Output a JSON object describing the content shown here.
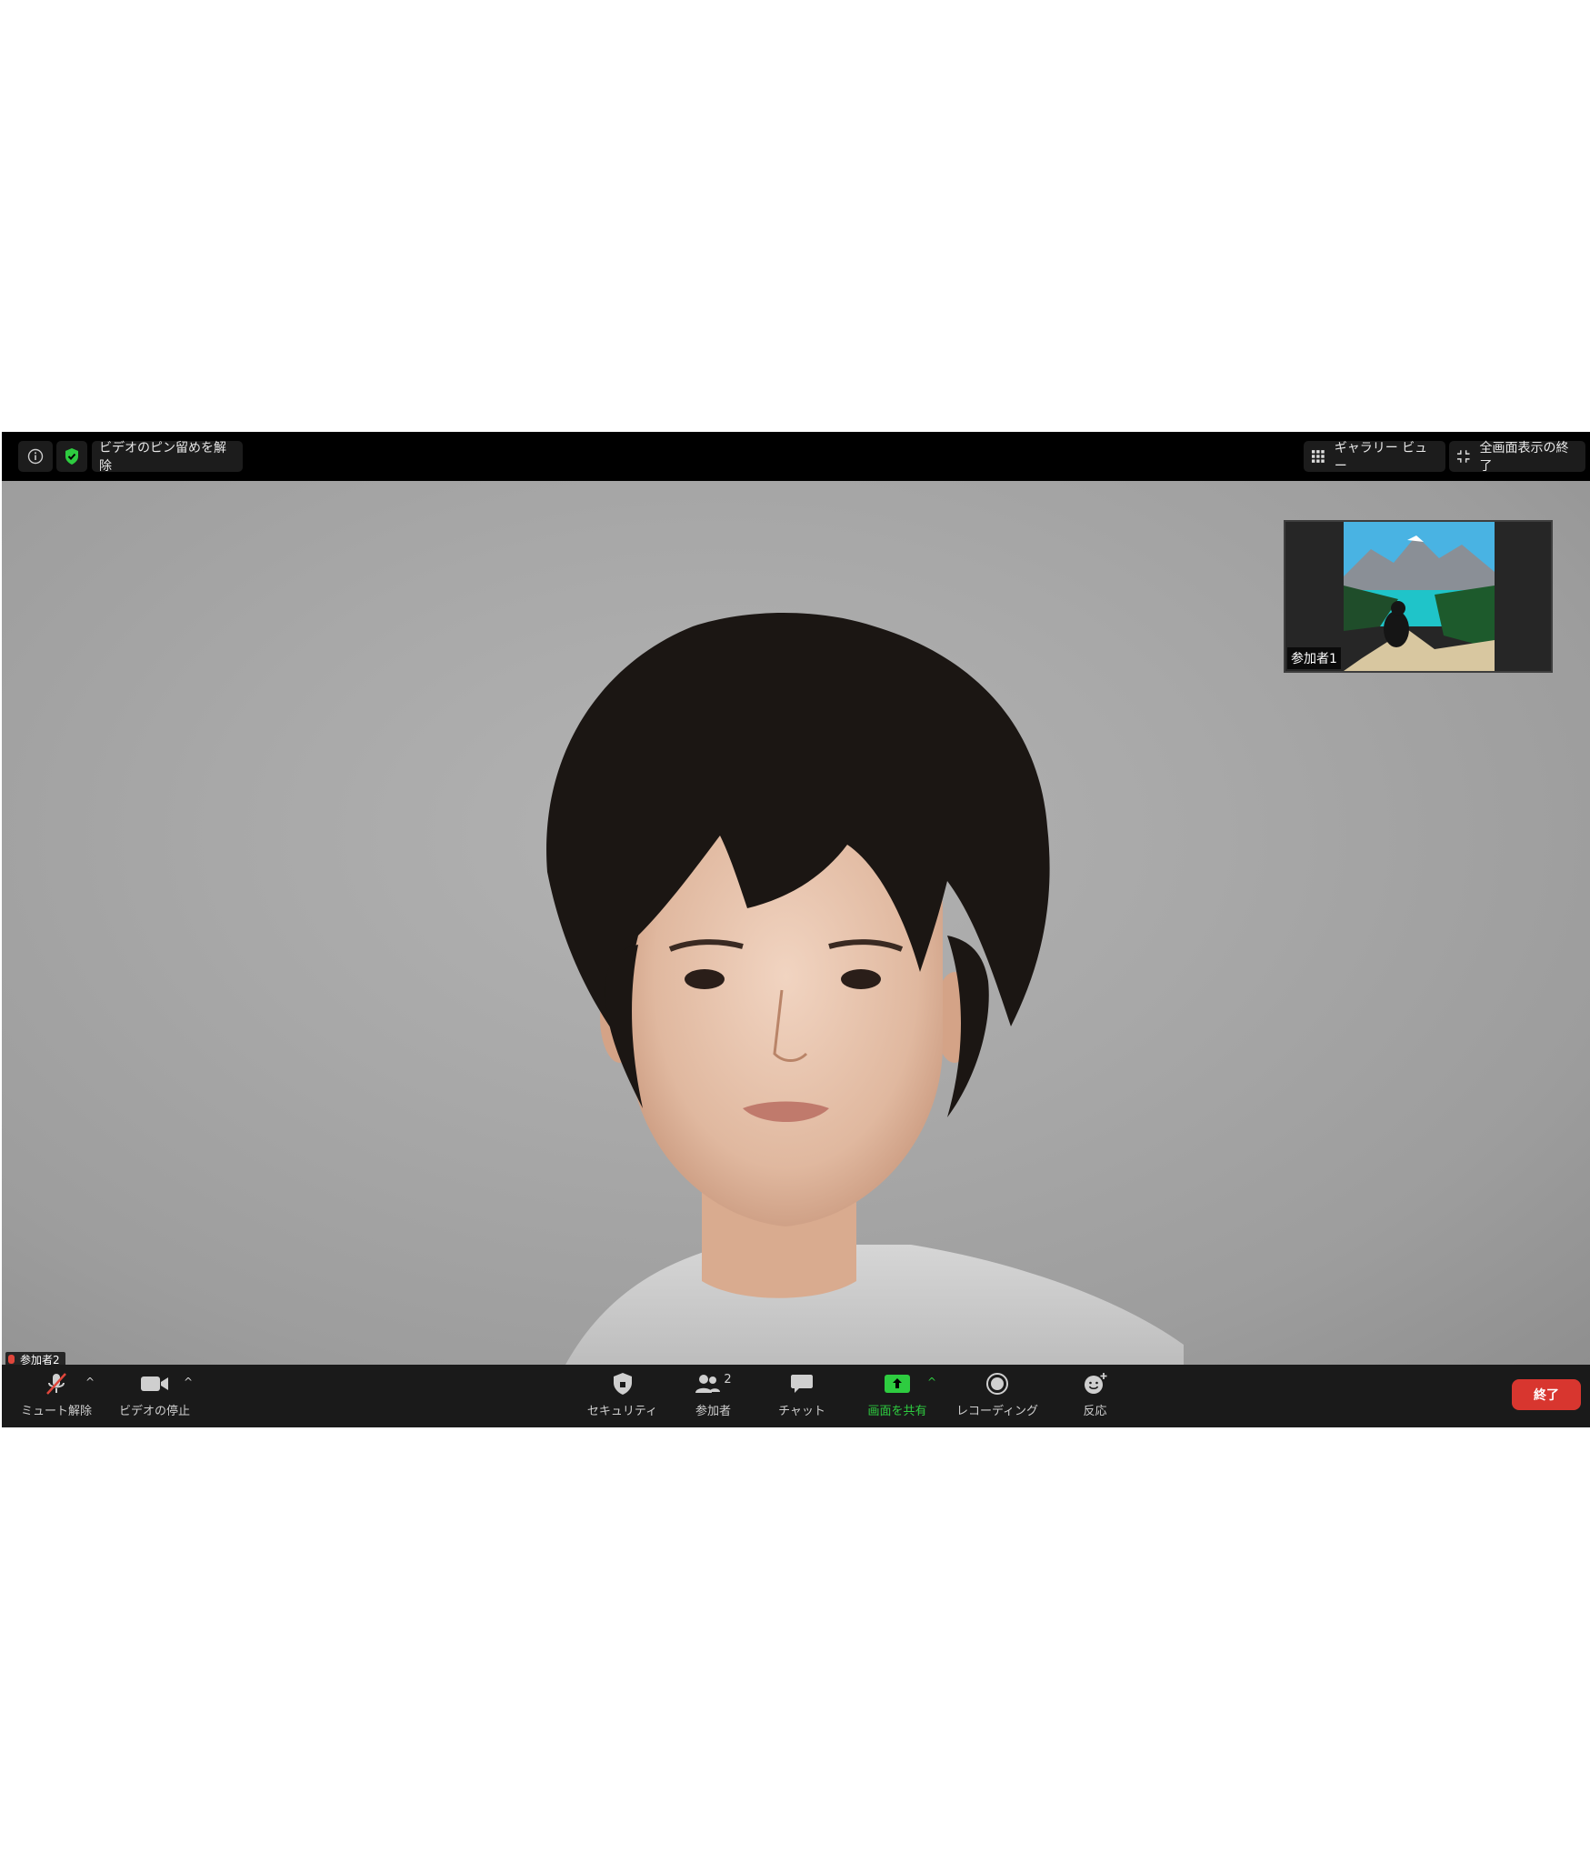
{
  "topbar": {
    "info_icon": "info-icon",
    "shield_icon": "shield-check-icon",
    "unpin_label": "ビデオのピン留めを解除",
    "gallery_label": "ギャラリー ビュー",
    "exit_fullscreen_label": "全画面表示の終了"
  },
  "main_video": {
    "participant_label": "参加者2"
  },
  "thumbnail": {
    "participant_label": "参加者1"
  },
  "toolbar": {
    "unmute_label": "ミュート解除",
    "stop_video_label": "ビデオの停止",
    "security_label": "セキュリティ",
    "participants_label": "参加者",
    "participants_count": "2",
    "chat_label": "チャット",
    "share_label": "画面を共有",
    "record_label": "レコーディング",
    "reactions_label": "反応",
    "end_label": "終了"
  },
  "colors": {
    "share_green": "#2ecc40",
    "end_red": "#d8362f",
    "shield_green": "#2ecc40"
  }
}
